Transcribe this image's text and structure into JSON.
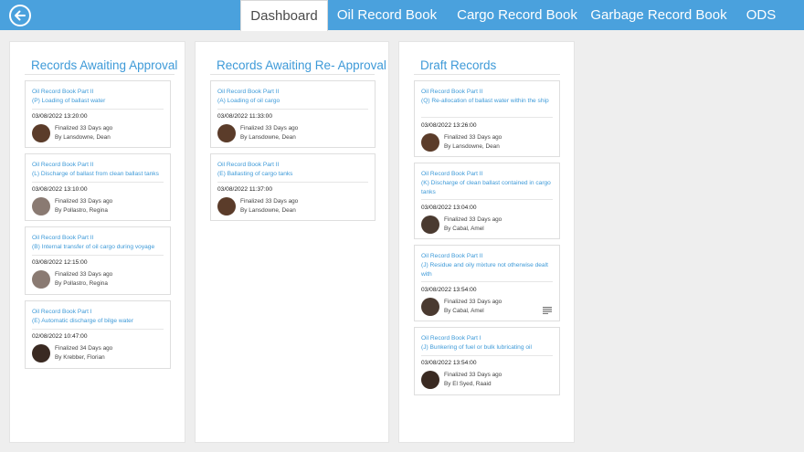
{
  "nav": {
    "back_icon": "back-arrow-icon",
    "tabs": [
      "Dashboard",
      "Oil Record Book",
      "Cargo Record Book",
      "Garbage Record Book",
      "ODS"
    ],
    "active_tab": "Dashboard"
  },
  "colors": {
    "accent": "#4aa1dd",
    "link": "#3e9ad8",
    "background": "#eeeeee"
  },
  "columns": [
    {
      "title": "Records Awaiting Approval",
      "cards": [
        {
          "type": "Oil Record Book Part II",
          "desc": "(P) Loading of ballast water",
          "date": "03/08/2022 13:20:00",
          "status": "Finalized 33 Days ago",
          "author": "By Lansdowne, Dean"
        },
        {
          "type": "Oil Record Book Part II",
          "desc": "(L) Discharge of ballast from clean ballast tanks",
          "date": "03/08/2022 13:10:00",
          "status": "Finalized 33 Days ago",
          "author": "By Pollastro, Regina"
        },
        {
          "type": "Oil Record Book Part II",
          "desc": "(B) Internal transfer of oil cargo during voyage",
          "date": "03/08/2022 12:15:00",
          "status": "Finalized 33 Days ago",
          "author": "By Pollastro, Regina"
        },
        {
          "type": "Oil Record Book Part I",
          "desc": "(E) Automatic discharge of bilge water",
          "date": "02/08/2022 10:47:00",
          "status": "Finalized 34 Days ago",
          "author": "By Krebber, Florian"
        }
      ]
    },
    {
      "title": "Records Awaiting Re- Approval",
      "cards": [
        {
          "type": "Oil Record Book Part II",
          "desc": "(A) Loading of oil cargo",
          "date": "03/08/2022 11:33:00",
          "status": "Finalized 33 Days ago",
          "author": "By Lansdowne, Dean"
        },
        {
          "type": "Oil Record Book Part II",
          "desc": "(E) Ballasting of cargo tanks",
          "date": "03/08/2022 11:37:00",
          "status": "Finalized 33 Days ago",
          "author": "By Lansdowne, Dean"
        }
      ]
    },
    {
      "title": "Draft Records",
      "cards": [
        {
          "type": "Oil Record Book Part II",
          "desc": "(Q) Re-allocation of ballast water within the ship",
          "date": "03/08/2022 13:26:00",
          "status": "Finalized 33 Days ago",
          "author": "By Lansdowne, Dean"
        },
        {
          "type": "Oil Record Book Part II",
          "desc": "(K) Discharge of clean ballast contained in cargo tanks",
          "date": "03/08/2022 13:04:00",
          "status": "Finalized 33 Days ago",
          "author": "By Cabal, Amel"
        },
        {
          "type": "Oil Record Book Part II",
          "desc": "(J) Residue and oily mixture not otherwise dealt with",
          "date": "03/08/2022 13:54:00",
          "status": "Finalized 33 Days ago",
          "author": "By Cabal, Amel",
          "icon": "notes-icon"
        },
        {
          "type": "Oil Record Book Part I",
          "desc": "(J) Bunkering of fuel or bulk lubricating oil",
          "date": "03/08/2022 13:54:00",
          "status": "Finalized 33 Days ago",
          "author": "By El Syed, Raaid"
        }
      ]
    }
  ]
}
